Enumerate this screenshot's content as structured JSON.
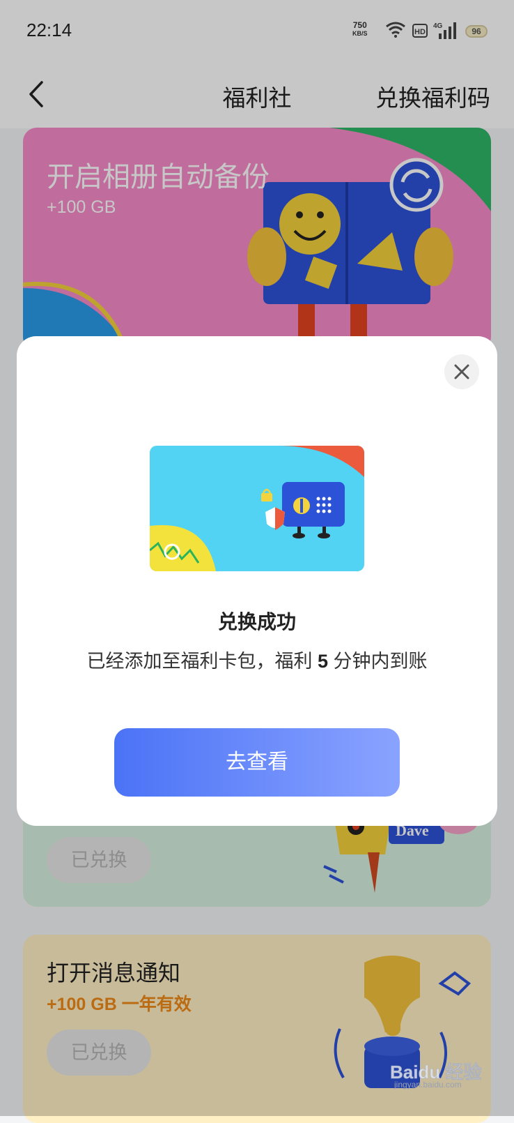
{
  "status_bar": {
    "time": "22:14",
    "net_speed": "750",
    "net_unit": "KB/S",
    "hd": "HD",
    "signal_type": "4G",
    "battery": "96"
  },
  "header": {
    "title": "福利社",
    "redeem_code": "兑换福利码"
  },
  "cards": [
    {
      "title": "开启相册自动备份",
      "sub": "+100 GB"
    },
    {
      "status": "已兑换",
      "name_tag": "Dave"
    },
    {
      "title": "打开消息通知",
      "sub": "+100 GB  一年有效",
      "status": "已兑换"
    }
  ],
  "dialog": {
    "title": "兑换成功",
    "msg_before": "已经添加至福利卡包，福利 ",
    "msg_number": "5",
    "msg_after": " 分钟内到账",
    "button": "去查看"
  },
  "watermark": {
    "brand": "Baidu 经验",
    "url": "jingyan.baidu.com"
  },
  "icons": [
    "back-icon",
    "close-icon",
    "wifi-icon",
    "signal-icon",
    "battery-icon",
    "refresh-icon"
  ]
}
